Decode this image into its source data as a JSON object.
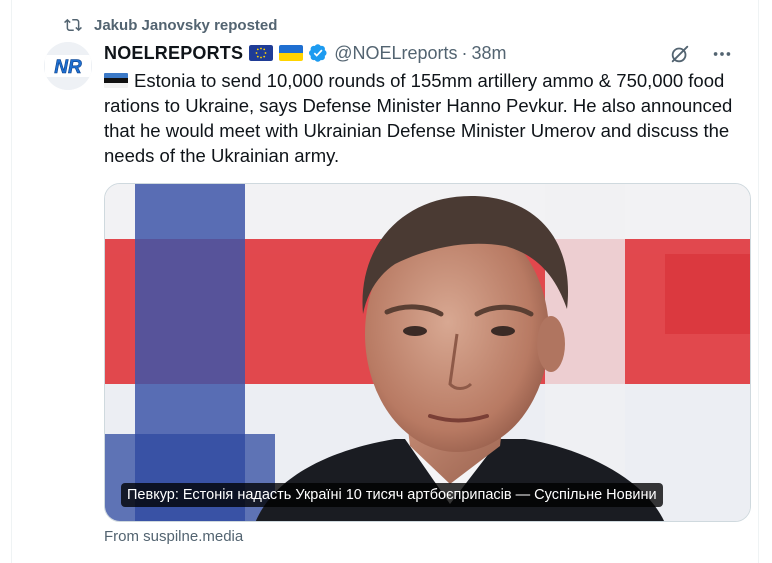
{
  "repost": {
    "text": "Jakub Janovsky reposted",
    "icon": "repost-icon"
  },
  "author": {
    "name": "NOELREPORTS",
    "avatar_text": "NR",
    "flags": [
      "eu-flag",
      "ukraine-flag"
    ],
    "verified": true,
    "handle": "@NOELreports",
    "separator": "·",
    "time": "38m"
  },
  "post": {
    "lead_flag": "estonia-flag",
    "text": "Estonia to send 10,000 rounds of 155mm artillery ammo & 750,000 food rations to Ukraine, says Defense Minister Hanno Pevkur. He also announced that he would meet with Ukrainian Defense Minister Umerov and discuss the needs of the Ukrainian army."
  },
  "link_card": {
    "caption": "Певкур: Естонія надасть Україні 10 тисяч артбоєприпасів — Суспільне Новини",
    "source": "From suspilne.media"
  },
  "actions": [
    "grok-icon",
    "more-icon"
  ],
  "colors": {
    "verified": "#1d9bf0",
    "secondary_text": "#536471",
    "border": "#cfd9de"
  }
}
